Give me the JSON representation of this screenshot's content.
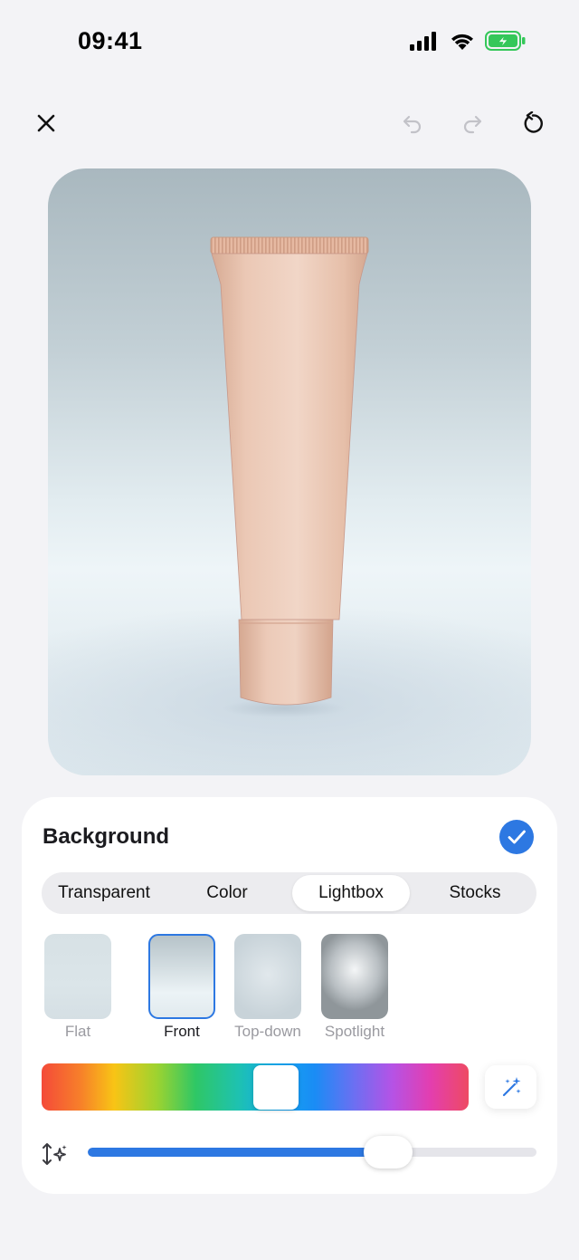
{
  "status_bar": {
    "time": "09:41",
    "icons": [
      "cellular-signal-icon",
      "wifi-icon",
      "battery-charging-icon"
    ],
    "battery_color": "#34c759"
  },
  "toolbar": {
    "close_icon": "close-icon",
    "undo_icon": "undo-icon",
    "redo_icon": "redo-icon",
    "reset_icon": "reset-icon"
  },
  "preview": {
    "subject": "product-tube-image"
  },
  "panel": {
    "title": "Background",
    "confirm_icon": "checkmark-icon",
    "tabs": [
      {
        "label": "Transparent",
        "active": false
      },
      {
        "label": "Color",
        "active": false
      },
      {
        "label": "Lightbox",
        "active": true
      },
      {
        "label": "Stocks",
        "active": false
      }
    ],
    "styles": [
      {
        "label": "Flat",
        "selected": false
      },
      {
        "label": "Front",
        "selected": true
      },
      {
        "label": "Top-down",
        "selected": false
      },
      {
        "label": "Spotlight",
        "selected": false
      }
    ],
    "hue": {
      "value": 0.55,
      "magic_icon": "magic-wand-icon"
    },
    "intensity": {
      "icon": "intensity-sparkle-icon",
      "value": 0.67
    },
    "accent_color": "#2d78e2"
  }
}
